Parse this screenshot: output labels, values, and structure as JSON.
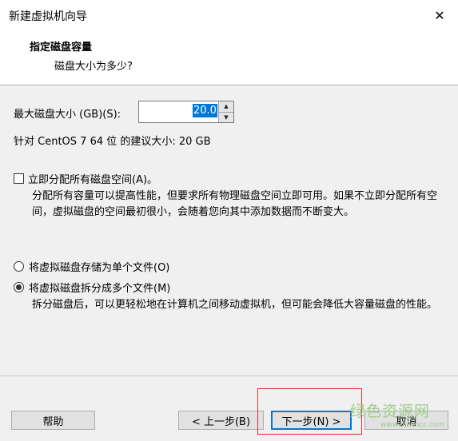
{
  "window": {
    "title": "新建虚拟机向导",
    "close_glyph": "✕"
  },
  "header": {
    "title": "指定磁盘容量",
    "subtitle": "磁盘大小为多少?"
  },
  "disk_size": {
    "label": "最大磁盘大小 (GB)(S):",
    "value": "20.0",
    "recommended": "针对 CentOS 7 64 位 的建议大小: 20 GB"
  },
  "allocate": {
    "label": "立即分配所有磁盘空间(A)。",
    "checked": false,
    "description": "分配所有容量可以提高性能，但要求所有物理磁盘空间立即可用。如果不立即分配所有空间，虚拟磁盘的空间最初很小，会随着您向其中添加数据而不断变大。"
  },
  "storage": {
    "single_file_label": "将虚拟磁盘存储为单个文件(O)",
    "multi_file_label": "将虚拟磁盘拆分成多个文件(M)",
    "selected": "multi",
    "multi_description": "拆分磁盘后，可以更轻松地在计算机之间移动虚拟机，但可能会降低大容量磁盘的性能。"
  },
  "buttons": {
    "help": "帮助",
    "back": "< 上一步(B)",
    "next": "下一步(N) >",
    "cancel": "取消"
  },
  "watermark": {
    "main": "绿色资源网",
    "sub": "www.downcc.com"
  },
  "colors": {
    "accent": "#0078d7",
    "highlight_box": "#e0302f",
    "watermark": "#9ccd8a"
  }
}
